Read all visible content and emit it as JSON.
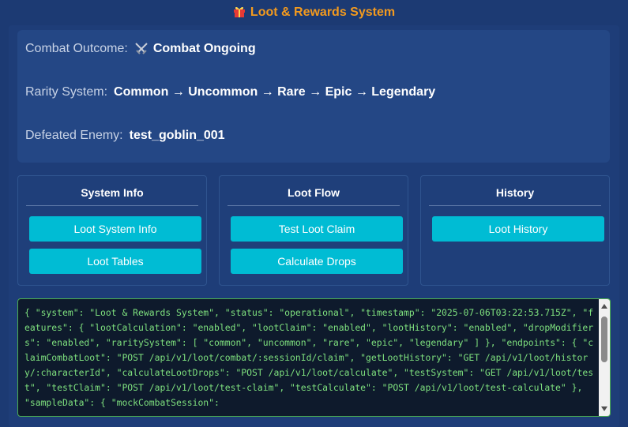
{
  "header": {
    "title": "Loot & Rewards System",
    "icon": "gift-icon"
  },
  "info": {
    "combat_outcome_label": "Combat Outcome:",
    "combat_outcome_value": "Combat Ongoing",
    "combat_outcome_icon": "crossed-swords-icon",
    "rarity_label": "Rarity System:",
    "rarity_value": "Common → Uncommon → Rare → Epic → Legendary",
    "enemy_label": "Defeated Enemy:",
    "enemy_value": "test_goblin_001"
  },
  "panels": {
    "system_info": {
      "title": "System Info",
      "buttons": [
        "Loot System Info",
        "Loot Tables"
      ]
    },
    "loot_flow": {
      "title": "Loot Flow",
      "buttons": [
        "Test Loot Claim",
        "Calculate Drops"
      ]
    },
    "history": {
      "title": "History",
      "buttons": [
        "Loot History"
      ]
    }
  },
  "console": {
    "text": "{ \"system\": \"Loot & Rewards System\", \"status\": \"operational\", \"timestamp\": \"2025-07-06T03:22:53.715Z\", \"features\": { \"lootCalculation\": \"enabled\", \"lootClaim\": \"enabled\", \"lootHistory\": \"enabled\", \"dropModifiers\": \"enabled\", \"raritySystem\": [ \"common\", \"uncommon\", \"rare\", \"epic\", \"legendary\" ] }, \"endpoints\": { \"claimCombatLoot\": \"POST /api/v1/loot/combat/:sessionId/claim\", \"getLootHistory\": \"GET /api/v1/loot/history/:characterId\", \"calculateLootDrops\": \"POST /api/v1/loot/calculate\", \"testSystem\": \"GET /api/v1/loot/test\", \"testClaim\": \"POST /api/v1/loot/test-claim\", \"testCalculate\": \"POST /api/v1/loot/test-calculate\" }, \"sampleData\": { \"mockCombatSession\":"
  },
  "colors": {
    "accent": "#f39a1e",
    "button": "#00bcd4",
    "console_text": "#7ee07e",
    "console_border": "#4caf50"
  }
}
